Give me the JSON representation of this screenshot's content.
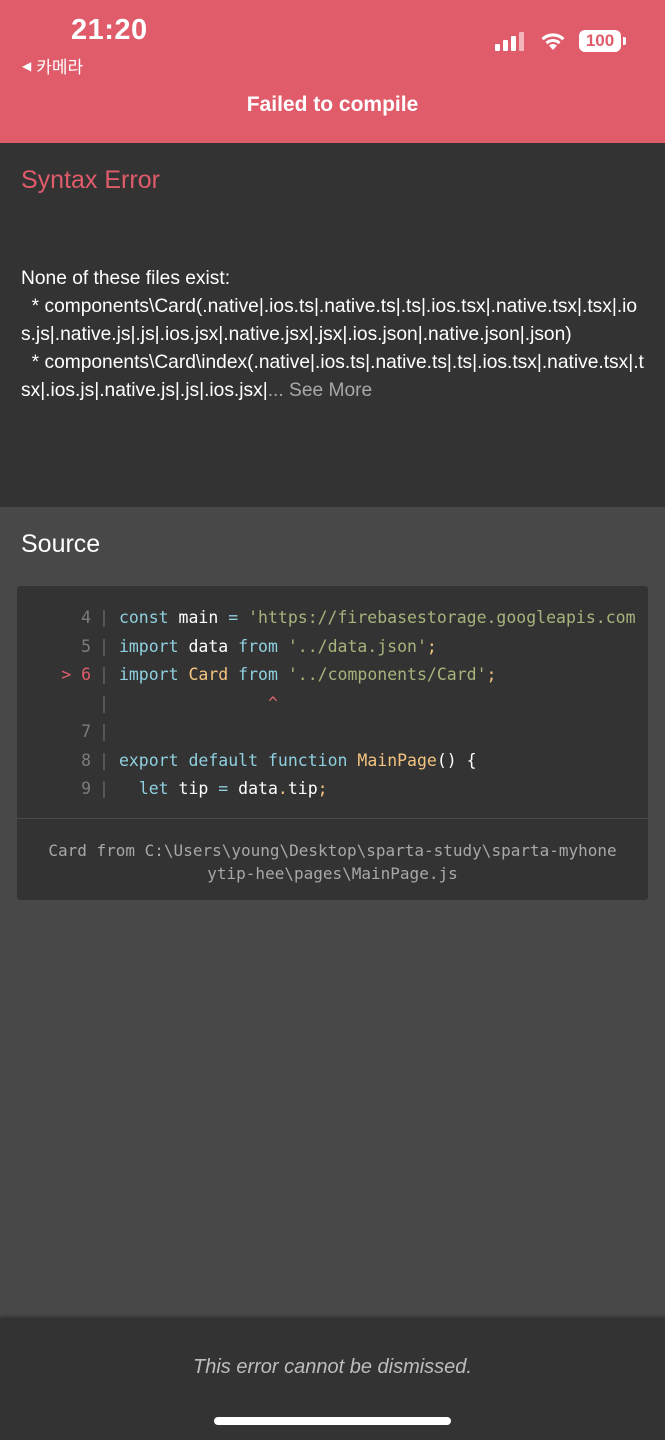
{
  "status_bar": {
    "time": "21:20",
    "back_label": "카메라",
    "battery": "100",
    "icons": [
      "cellular-signal-icon",
      "wifi-icon",
      "battery-icon"
    ]
  },
  "header": {
    "title": "Failed to compile"
  },
  "error": {
    "title": "Syntax Error",
    "message": "None of these files exist:\n  * components\\Card(.native|.ios.ts|.native.ts|.ts|.ios.tsx|.native.tsx|.tsx|.ios.js|.native.js|.js|.ios.jsx|.native.jsx|.jsx|.ios.json|.native.json|.json)\n  * components\\Card\\index(.native|.ios.ts|.native.ts|.ts|.ios.tsx|.native.tsx|.tsx|.ios.js|.native.js|.js|.ios.jsx|",
    "see_more": "... See More"
  },
  "source": {
    "title": "Source",
    "lines": [
      {
        "marker": "",
        "number": "4",
        "tokens": [
          {
            "text": "const",
            "kind": "kw"
          },
          {
            "text": " main ",
            "kind": "plain"
          },
          {
            "text": "=",
            "kind": "kw"
          },
          {
            "text": " 'https://firebasestorage.googleapis.com",
            "kind": "str"
          }
        ]
      },
      {
        "marker": "",
        "number": "5",
        "tokens": [
          {
            "text": "import",
            "kind": "kw"
          },
          {
            "text": " data ",
            "kind": "plain"
          },
          {
            "text": "from",
            "kind": "kw"
          },
          {
            "text": " '../data.json'",
            "kind": "str"
          },
          {
            "text": ";",
            "kind": "ident"
          }
        ]
      },
      {
        "marker": ">",
        "number": "6",
        "tokens": [
          {
            "text": "import",
            "kind": "kw"
          },
          {
            "text": " ",
            "kind": "plain"
          },
          {
            "text": "Card",
            "kind": "ident"
          },
          {
            "text": " ",
            "kind": "plain"
          },
          {
            "text": "from",
            "kind": "kw"
          },
          {
            "text": " '../components/Card'",
            "kind": "str"
          },
          {
            "text": ";",
            "kind": "ident"
          }
        ]
      },
      {
        "marker": "",
        "number": "",
        "tokens": [
          {
            "text": "               ^",
            "kind": "op"
          }
        ]
      },
      {
        "marker": "",
        "number": "7",
        "tokens": []
      },
      {
        "marker": "",
        "number": "8",
        "tokens": [
          {
            "text": "export",
            "kind": "kw"
          },
          {
            "text": " ",
            "kind": "plain"
          },
          {
            "text": "default",
            "kind": "kw"
          },
          {
            "text": " ",
            "kind": "plain"
          },
          {
            "text": "function",
            "kind": "kw"
          },
          {
            "text": " ",
            "kind": "plain"
          },
          {
            "text": "MainPage",
            "kind": "ident"
          },
          {
            "text": "() {",
            "kind": "plain"
          }
        ]
      },
      {
        "marker": "",
        "number": "9",
        "tokens": [
          {
            "text": "  ",
            "kind": "plain"
          },
          {
            "text": "let",
            "kind": "kw"
          },
          {
            "text": " tip ",
            "kind": "plain"
          },
          {
            "text": "=",
            "kind": "kw"
          },
          {
            "text": " data",
            "kind": "plain"
          },
          {
            "text": ".",
            "kind": "ident"
          },
          {
            "text": "tip",
            "kind": "plain"
          },
          {
            "text": ";",
            "kind": "ident"
          }
        ]
      }
    ],
    "footer_path": "Card from C:\\Users\\young\\Desktop\\sparta-study\\sparta-myhoneytip-hee\\pages\\MainPage.js"
  },
  "footer": {
    "dismiss_text": "This error cannot be dismissed."
  },
  "colors": {
    "header_bg": "#e05c6b",
    "panel_bg": "#333333",
    "page_bg": "#484848",
    "error_accent": "#e05c6b",
    "keyword": "#8fd0e0",
    "string": "#a5b47c",
    "identifier": "#f2c47f"
  }
}
